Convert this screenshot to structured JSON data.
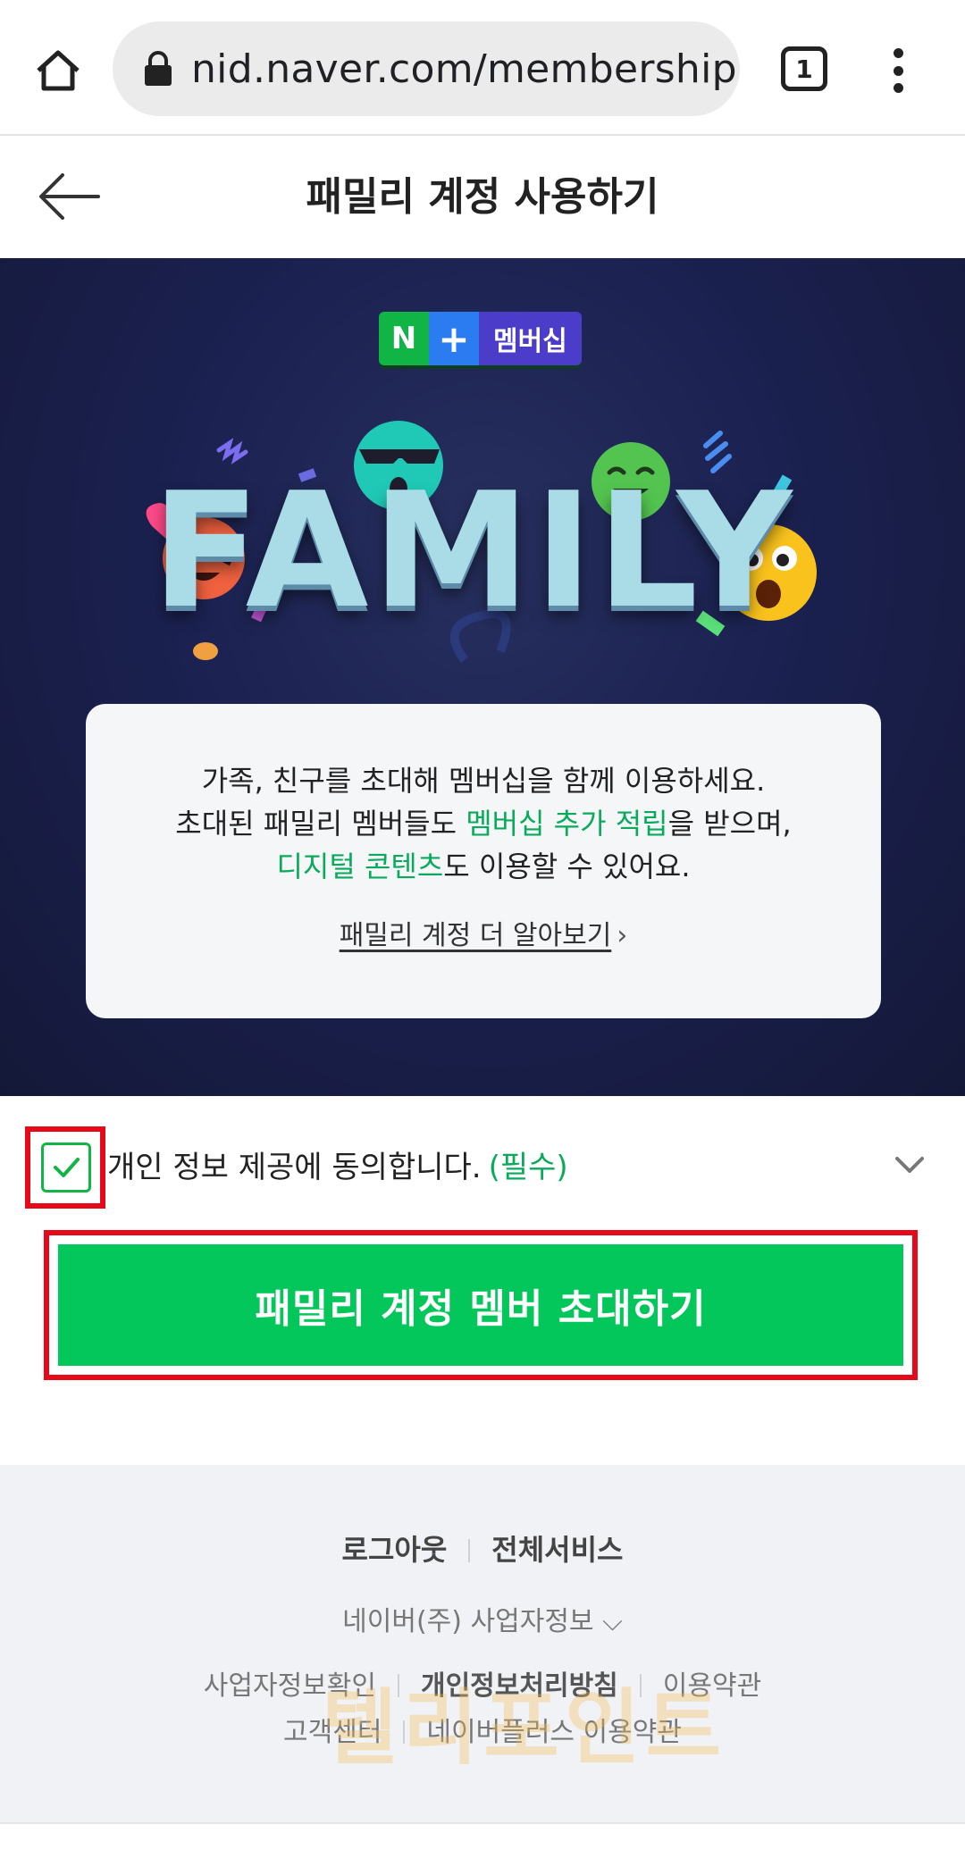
{
  "browser": {
    "url": "nid.naver.com/membership/",
    "tab_count": "1"
  },
  "header": {
    "title": "패밀리 계정 사용하기"
  },
  "hero": {
    "badge_n": "N",
    "badge_plus": "+",
    "badge_text": "멤버십",
    "family_word": "FAMILY"
  },
  "info": {
    "line1": "가족, 친구를 초대해 멤버십을 함께 이용하세요.",
    "line2_pre": "초대된 패밀리 멤버들도 ",
    "line2_green": "멤버십 추가 적립",
    "line2_post": "을 받으며,",
    "line3_green": "디지털 콘텐츠",
    "line3_post": "도 이용할 수 있어요.",
    "learn_more": "패밀리 계정 더 알아보기",
    "learn_more_arrow": "›"
  },
  "consent": {
    "label": "개인 정보 제공에 동의합니다.",
    "required": "(필수)",
    "checked": true
  },
  "cta": {
    "label": "패밀리 계정 멤버 초대하기"
  },
  "footer": {
    "logout": "로그아웃",
    "all_services": "전체서비스",
    "biz_info": "네이버(주) 사업자정보",
    "biz_info_chevron": "⌵",
    "biz_check": "사업자정보확인",
    "privacy": "개인정보처리방침",
    "terms": "이용약관",
    "support": "고객센터",
    "plus_terms": "네이버플러스 이용약관",
    "watermark": "텔리포인트"
  },
  "colors": {
    "accent_green": "#03c75a",
    "highlight_red": "#e5091a",
    "hero_bg": "#1b2150"
  }
}
